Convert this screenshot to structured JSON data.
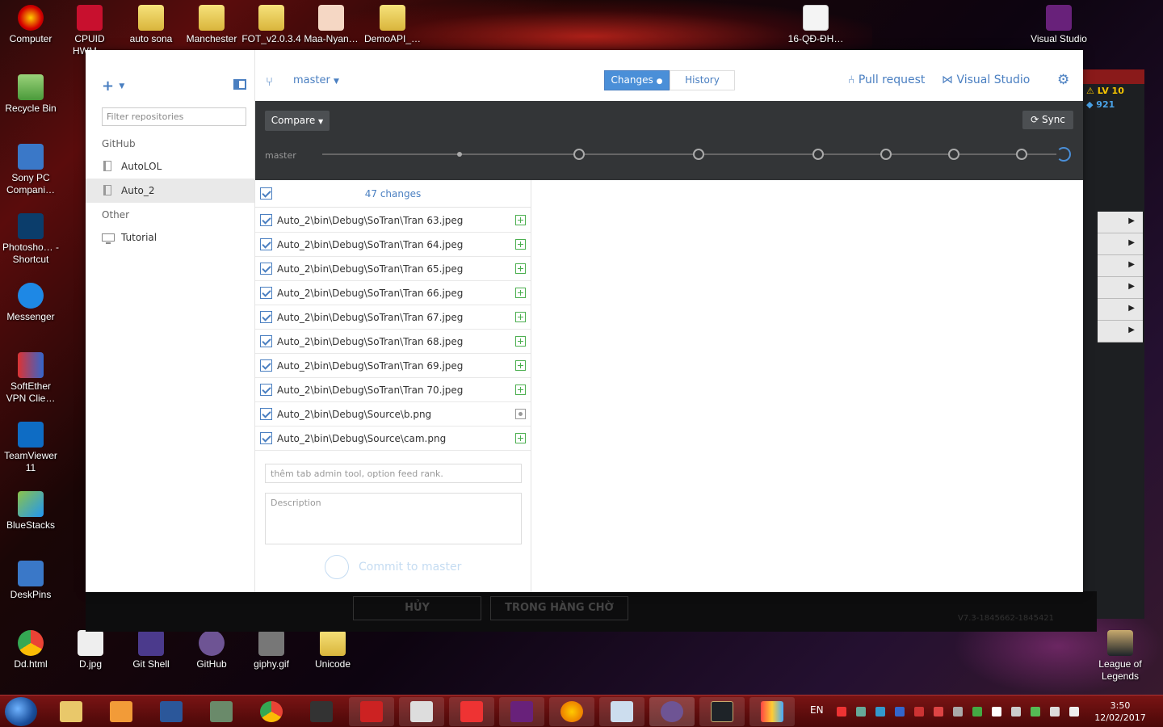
{
  "desktop": {
    "icons_top": [
      "Computer",
      "CPUID HWM…",
      "auto sona",
      "Manchester",
      "FOT_v2.0.3.4",
      "Maa-Nyan…",
      "DemoAPI_…",
      "16-QĐ-ĐH…",
      "Visual Studio"
    ],
    "icons_left": [
      "Recycle Bin",
      "Sony PC Compani…",
      "Photosho… - Shortcut",
      "Messenger",
      "SoftEther VPN Clie…",
      "TeamViewer 11",
      "BlueStacks",
      "DeskPins"
    ],
    "icons_bottom": [
      "Dd.html",
      "D.jpg",
      "Git Shell",
      "GitHub",
      "giphy.gif",
      "Unicode"
    ],
    "icon_bottom_right": "League of Legends"
  },
  "background_apps": {
    "level": "LV 10",
    "gems": "921",
    "cancel_label": "HỦY",
    "queue_label": "TRONG HÀNG CHỜ",
    "version": "V7.3-1845662-1845421"
  },
  "window": {
    "controls": {
      "minimize": "–",
      "maximize": "▭",
      "close": "✕"
    }
  },
  "sidebar": {
    "add_label": "+",
    "filter_placeholder": "Filter repositories",
    "sections": [
      {
        "title": "GitHub",
        "items": [
          "AutoLOL",
          "Auto_2"
        ]
      },
      {
        "title": "Other",
        "items": [
          "Tutorial"
        ]
      }
    ],
    "active_item": "Auto_2"
  },
  "topbar": {
    "branch": "master",
    "tabs": [
      {
        "label": "Changes",
        "active": true
      },
      {
        "label": "History",
        "active": false
      }
    ],
    "pull_request": "Pull request",
    "visual_studio": "Visual Studio"
  },
  "sync_bar": {
    "compare_label": "Compare",
    "sync_label": "Sync",
    "branch_label": "master"
  },
  "changes": {
    "count_label": "47 changes",
    "files": [
      {
        "path": "Auto_2\\bin\\Debug\\SoTran\\Tran 63.jpeg",
        "status": "added"
      },
      {
        "path": "Auto_2\\bin\\Debug\\SoTran\\Tran 64.jpeg",
        "status": "added"
      },
      {
        "path": "Auto_2\\bin\\Debug\\SoTran\\Tran 65.jpeg",
        "status": "added"
      },
      {
        "path": "Auto_2\\bin\\Debug\\SoTran\\Tran 66.jpeg",
        "status": "added"
      },
      {
        "path": "Auto_2\\bin\\Debug\\SoTran\\Tran 67.jpeg",
        "status": "added"
      },
      {
        "path": "Auto_2\\bin\\Debug\\SoTran\\Tran 68.jpeg",
        "status": "added"
      },
      {
        "path": "Auto_2\\bin\\Debug\\SoTran\\Tran 69.jpeg",
        "status": "added"
      },
      {
        "path": "Auto_2\\bin\\Debug\\SoTran\\Tran 70.jpeg",
        "status": "added"
      },
      {
        "path": "Auto_2\\bin\\Debug\\Source\\b.png",
        "status": "modified"
      },
      {
        "path": "Auto_2\\bin\\Debug\\Source\\cam.png",
        "status": "added"
      }
    ],
    "summary_placeholder": "thêm tab admin tool, option feed rank.",
    "description_placeholder": "Description",
    "commit_label": "Commit to master"
  },
  "taskbar": {
    "language": "EN",
    "time": "3:50",
    "date": "12/02/2017"
  },
  "colors": {
    "accent": "#4a7fc1",
    "added": "#4caf50",
    "dark_bar": "#333537"
  }
}
